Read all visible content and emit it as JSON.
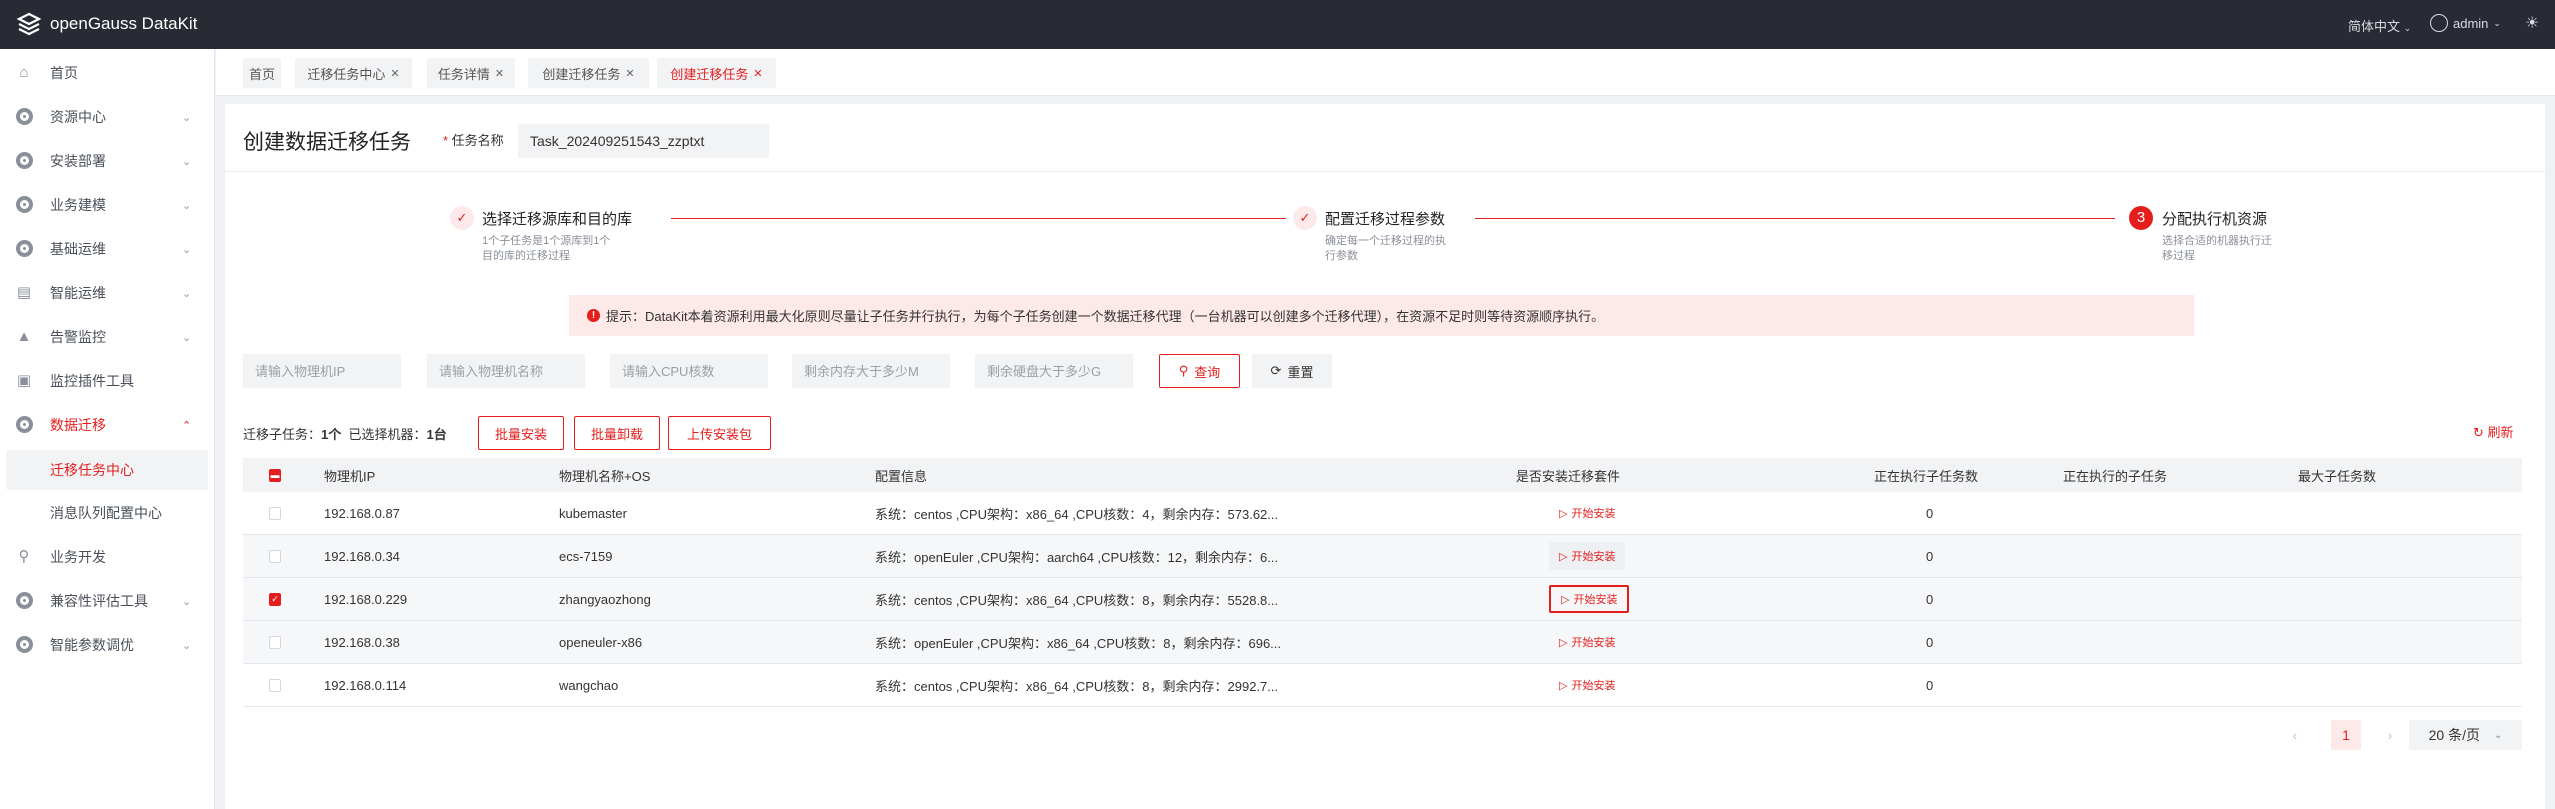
{
  "app": {
    "title": "openGauss DataKit",
    "language": "简体中文",
    "user": "admin"
  },
  "sidebar": {
    "items": [
      {
        "label": "首页",
        "icon": "home-icon"
      },
      {
        "label": "资源中心",
        "icon": "gear-icon"
      },
      {
        "label": "安装部署",
        "icon": "gear-icon"
      },
      {
        "label": "业务建模",
        "icon": "gear-icon"
      },
      {
        "label": "基础运维",
        "icon": "gear-icon"
      },
      {
        "label": "智能运维",
        "icon": "monitor-icon"
      },
      {
        "label": "告警监控",
        "icon": "alarm-icon"
      },
      {
        "label": "监控插件工具",
        "icon": "plugin-icon"
      },
      {
        "label": "数据迁移",
        "icon": "gear-icon"
      },
      {
        "label": "迁移任务中心"
      },
      {
        "label": "消息队列配置中心"
      },
      {
        "label": "业务开发",
        "icon": "search-icon"
      },
      {
        "label": "兼容性评估工具",
        "icon": "gear-icon"
      },
      {
        "label": "智能参数调优",
        "icon": "gear-icon"
      }
    ]
  },
  "tabs": [
    {
      "label": "首页"
    },
    {
      "label": "迁移任务中心"
    },
    {
      "label": "任务详情"
    },
    {
      "label": "创建迁移任务"
    },
    {
      "label": "创建迁移任务"
    }
  ],
  "page": {
    "title": "创建数据迁移任务",
    "name_label": "任务名称",
    "name_value": "Task_202409251543_zzptxt"
  },
  "steps": [
    {
      "title": "选择迁移源库和目的库",
      "desc": "1个子任务是1个源库到1个目的库的迁移过程",
      "status": "done"
    },
    {
      "title": "配置迁移过程参数",
      "desc": "确定每一个迁移过程的执行参数",
      "status": "done"
    },
    {
      "number": "3",
      "title": "分配执行机资源",
      "desc": "选择合适的机器执行迁移过程",
      "status": "current"
    }
  ],
  "alert": "提示：DataKit本着资源利用最大化原则尽量让子任务并行执行，为每个子任务创建一个数据迁移代理（一台机器可以创建多个迁移代理），在资源不足时则等待资源顺序执行。",
  "filters": {
    "ip": "请输入物理机IP",
    "name": "请输入物理机名称",
    "cpu": "请输入CPU核数",
    "mem": "剩余内存大于多少M",
    "disk": "剩余硬盘大于多少G",
    "query": "查询",
    "reset": "重置"
  },
  "toolbar": {
    "subtask_label": "迁移子任务：",
    "subtask_count": "1个",
    "selected_label": "已选择机器：",
    "selected_count": "1台",
    "batch_install": "批量安装",
    "batch_uninstall": "批量卸载",
    "upload": "上传安装包",
    "refresh": "刷新"
  },
  "table": {
    "columns": [
      "物理机IP",
      "物理机名称+OS",
      "配置信息",
      "是否安装迁移套件",
      "正在执行子任务数",
      "正在执行的子任务",
      "最大子任务数"
    ],
    "rows": [
      {
        "ip": "192.168.0.87",
        "name": "kubemaster",
        "config": "系统：centos ,CPU架构：x86_64 ,CPU核数：4，剩余内存：573.62...",
        "action": "开始安装",
        "running": "0",
        "checked": false
      },
      {
        "ip": "192.168.0.34",
        "name": "ecs-7159",
        "config": "系统：openEuler ,CPU架构：aarch64 ,CPU核数：12，剩余内存：6...",
        "action": "开始安装",
        "running": "0",
        "checked": false
      },
      {
        "ip": "192.168.0.229",
        "name": "zhangyaozhong",
        "config": "系统：centos ,CPU架构：x86_64 ,CPU核数：8，剩余内存：5528.8...",
        "action": "开始安装",
        "running": "0",
        "checked": true
      },
      {
        "ip": "192.168.0.38",
        "name": "openeuler-x86",
        "config": "系统：openEuler ,CPU架构：x86_64 ,CPU核数：8，剩余内存：696...",
        "action": "开始安装",
        "running": "0",
        "checked": false
      },
      {
        "ip": "192.168.0.114",
        "name": "wangchao",
        "config": "系统：centos ,CPU架构：x86_64 ,CPU核数：8，剩余内存：2992.7...",
        "action": "开始安装",
        "running": "0",
        "checked": false
      }
    ]
  },
  "pagination": {
    "current": "1",
    "page_size": "20 条/页"
  },
  "colors": {
    "accent": "#e41d1d",
    "header_bg": "#282b33"
  }
}
